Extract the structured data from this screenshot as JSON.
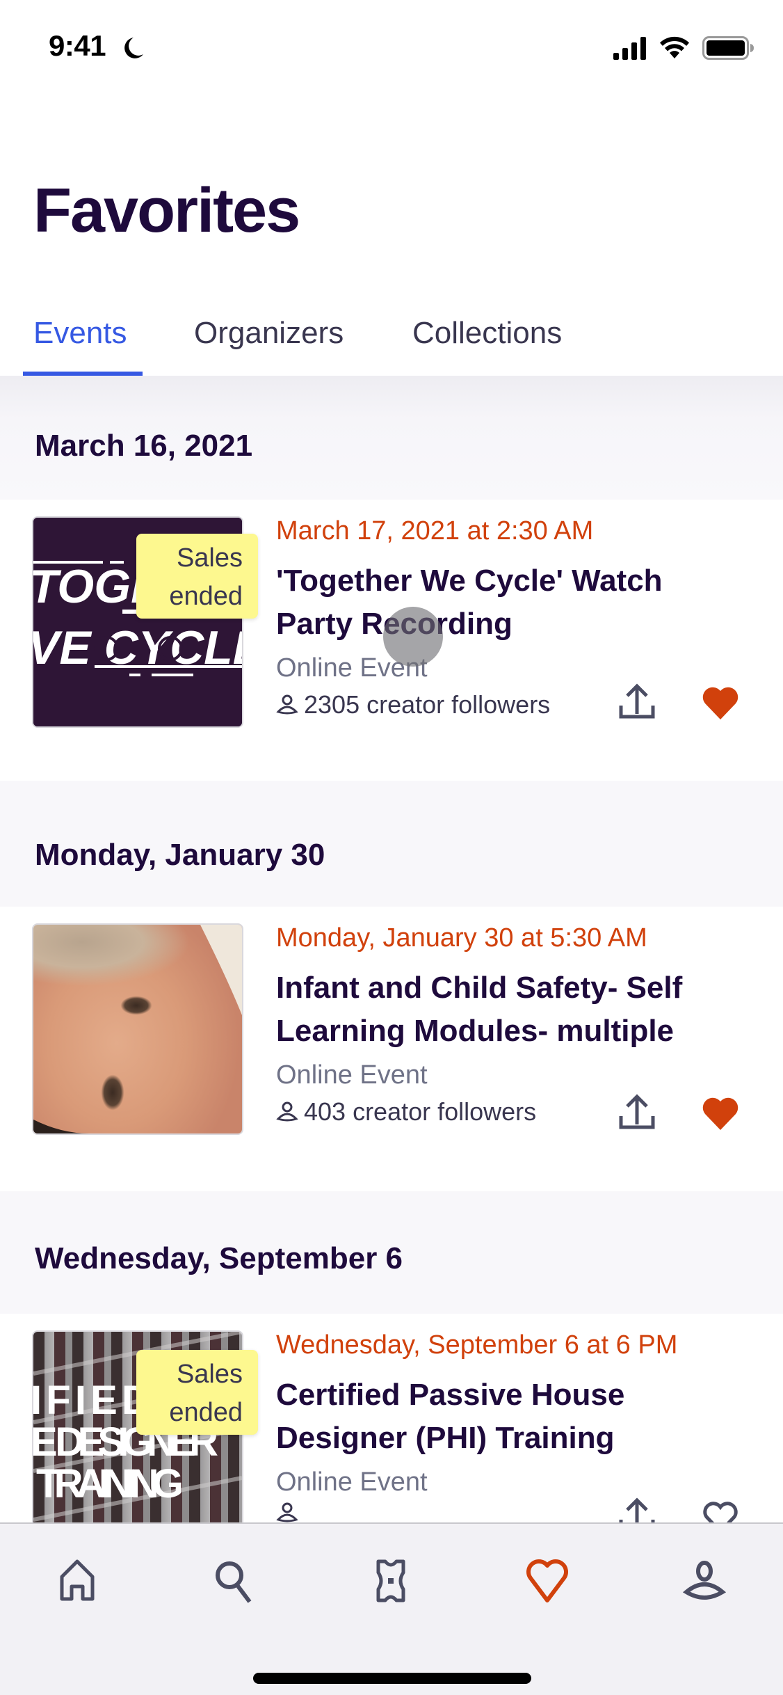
{
  "status_bar": {
    "time": "9:41",
    "icons": [
      "moon-icon",
      "cellular-signal-icon",
      "wifi-icon",
      "battery-icon"
    ]
  },
  "header": {
    "title": "Favorites"
  },
  "tabs": [
    {
      "label": "Events",
      "active": true
    },
    {
      "label": "Organizers",
      "active": false
    },
    {
      "label": "Collections",
      "active": false
    }
  ],
  "colors": {
    "brand_dark": "#1e0a3c",
    "accent_blue": "#3659e3",
    "date_orange": "#d1410c",
    "heart_red": "#d1410c",
    "badge_yellow": "#fdf88f",
    "muted_text": "#6f7287"
  },
  "sections": [
    {
      "header": "March 16, 2021",
      "events": [
        {
          "date": "March 17, 2021 at 2:30 AM",
          "title": "'Together We Cycle' Watch Party Recording",
          "location": "Online Event",
          "followers": "2305 creator followers",
          "badge": "Sales ended",
          "badge_line1": "Sales",
          "badge_line2": "ended",
          "image_text_line1": "TOGE",
          "image_text_line2": "VE CYCLE",
          "favorited": true
        }
      ]
    },
    {
      "header": "Monday, January 30",
      "events": [
        {
          "date": "Monday, January 30 at 5:30 AM",
          "title": "Infant and Child Safety- Self Learning Modules- multiple",
          "location": "Online Event",
          "followers": "403 creator followers",
          "favorited": true
        }
      ]
    },
    {
      "header": "Wednesday, September 6",
      "events": [
        {
          "date": "Wednesday, September 6 at 6 PM",
          "title": "Certified Passive House Designer (PHI) Training",
          "location": "Online Event",
          "followers": "",
          "badge": "Sales ended",
          "badge_line1": "Sales",
          "badge_line2": "ended",
          "image_text_line1": "IFIED P",
          "image_text_line2": "E DESIGNER",
          "image_text_line3": "TRAINING",
          "favorited": false
        }
      ]
    }
  ],
  "bottom_nav": [
    {
      "name": "home",
      "icon": "home-icon",
      "active": false
    },
    {
      "name": "search",
      "icon": "search-icon",
      "active": false
    },
    {
      "name": "tickets",
      "icon": "ticket-icon",
      "active": false
    },
    {
      "name": "likes",
      "icon": "heart-icon",
      "active": true
    },
    {
      "name": "profile",
      "icon": "profile-icon",
      "active": false
    }
  ]
}
